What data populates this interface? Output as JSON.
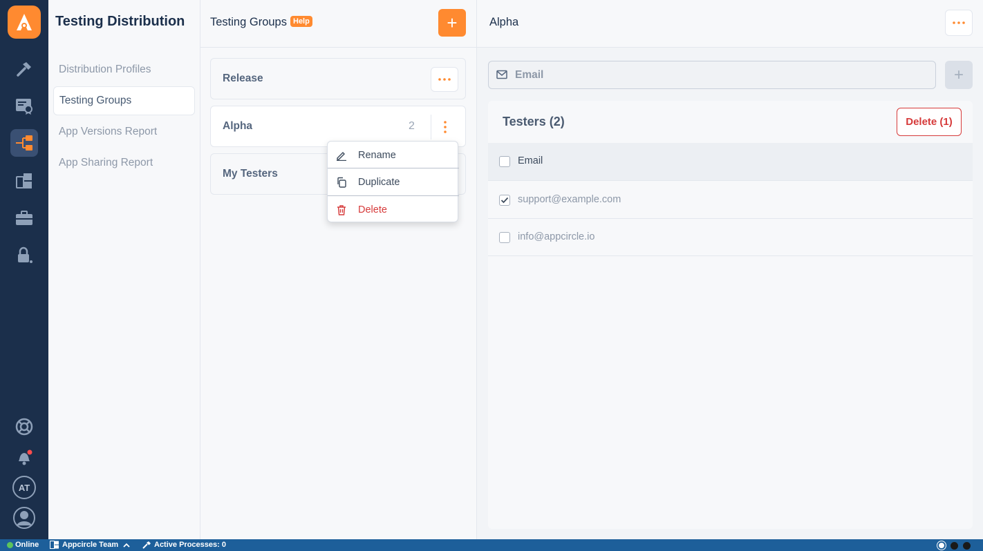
{
  "subnav": {
    "title": "Testing Distribution",
    "items": [
      {
        "label": "Distribution Profiles"
      },
      {
        "label": "Testing Groups"
      },
      {
        "label": "App Versions Report"
      },
      {
        "label": "App Sharing Report"
      }
    ]
  },
  "rail": {
    "avatar_initials": "AT"
  },
  "groups": {
    "title": "Testing Groups",
    "help_label": "Help",
    "add_label": "+",
    "list": [
      {
        "name": "Release"
      },
      {
        "name": "Alpha",
        "count": "2"
      },
      {
        "name": "My Testers"
      }
    ]
  },
  "context_menu": {
    "rename": "Rename",
    "duplicate": "Duplicate",
    "delete": "Delete"
  },
  "detail": {
    "title": "Alpha",
    "email_placeholder": "Email",
    "add_label": "+",
    "testers_title": "Testers (2)",
    "delete_label": "Delete (1)",
    "column_email": "Email",
    "rows": [
      {
        "email": "support@example.com",
        "checked": true
      },
      {
        "email": "info@appcircle.io",
        "checked": false
      }
    ]
  },
  "status_bar": {
    "online": "Online",
    "team": "Appcircle Team",
    "processes": "Active Processes: 0"
  },
  "colors": {
    "accent": "#ff8a30",
    "rail": "#1b2f4b",
    "danger": "#d63a3a",
    "status_bar": "#1d5f9a",
    "online": "#5cc35c"
  }
}
